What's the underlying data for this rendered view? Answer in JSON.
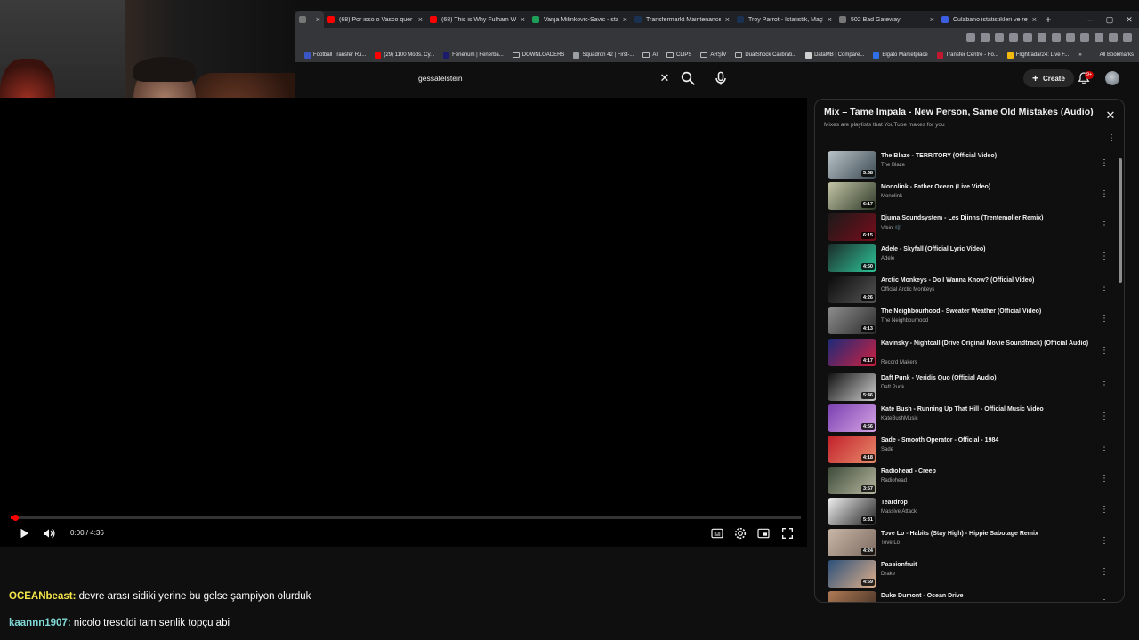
{
  "browser": {
    "tabs": [
      {
        "label": "",
        "color": "#777777",
        "active": true
      },
      {
        "label": "(68) Por isso o Vasco quer CO",
        "color": "#ff0000"
      },
      {
        "label": "(68) This is Why Fulham Wan",
        "color": "#ff0000"
      },
      {
        "label": "Vanja Milinkovic-Savic - statis",
        "color": "#1e9e57"
      },
      {
        "label": "Transfermarkt Maintenance",
        "color": "#1a3151"
      },
      {
        "label": "Troy Parrot - İstatistik, Maçla",
        "color": "#1a3151"
      },
      {
        "label": "502 Bad Gateway",
        "color": "#777777"
      },
      {
        "label": "Culabano istatistikleri ve reyti",
        "color": "#3b5fe0"
      }
    ],
    "new_tab": "+",
    "window_controls": [
      "–",
      "▢",
      "✕"
    ],
    "bookmarks": [
      {
        "label": "Football Transfer Ru...",
        "icon": "tf-icon"
      },
      {
        "label": "(29) 1100 Mods. Cy...",
        "icon": "youtube-icon"
      },
      {
        "label": "Fenerium | Fenerba...",
        "icon": "fenerium-icon"
      },
      {
        "label": "DOWNLOADERS",
        "icon": "folder-icon"
      },
      {
        "label": "Squadron 42 | First-...",
        "icon": "globe-icon"
      },
      {
        "label": "AI",
        "icon": "folder-icon"
      },
      {
        "label": "CLIPS",
        "icon": "folder-icon"
      },
      {
        "label": "ARŞİV",
        "icon": "folder-icon"
      },
      {
        "label": "DualShock Calibrati...",
        "icon": "folder-icon"
      },
      {
        "label": "DataMB | Compare...",
        "icon": "github-icon"
      },
      {
        "label": "Elgato Marketplace",
        "icon": "elgato-icon"
      },
      {
        "label": "Transfer Centre - Fo...",
        "icon": "transfer-icon"
      },
      {
        "label": "Flightradar24: Live F...",
        "icon": "radar-icon"
      }
    ],
    "all_bookmarks": "All Bookmarks"
  },
  "youtube": {
    "search_value": "gessafelstein",
    "create_label": "Create",
    "notification_count": "9+"
  },
  "player": {
    "time": "0:00 / 4:36",
    "progress": 0.004
  },
  "chat": [
    {
      "user": "OCEANbeast:",
      "message": " devre arası sidiki yerine bu gelse şampiyon olurduk"
    },
    {
      "user": "kaannn1907:",
      "message": " nicolo tresoldi tam senlik topçu abi"
    }
  ],
  "playlist": {
    "title": "Mix – Tame Impala - New Person, Same Old Mistakes (Audio)",
    "subtitle": "Mixes are playlists that YouTube makes for you",
    "items": [
      {
        "title": "The Blaze - TERRITORY (Official Video)",
        "channel": "The Blaze",
        "duration": "5:38",
        "c1": "#b9c3c9",
        "c2": "#3d4a52"
      },
      {
        "title": "Monolink - Father Ocean (Live Video)",
        "channel": "Monolink",
        "duration": "6:17",
        "c1": "#c4c6a6",
        "c2": "#2f3a2a"
      },
      {
        "title": "Djuma Soundsystem - Les Djinns (Trentemøller Remix)",
        "channel": "Vibin' 🎼",
        "duration": "6:15",
        "c1": "#1a1a1a",
        "c2": "#7a0d1a"
      },
      {
        "title": "Adele - Skyfall (Official Lyric Video)",
        "channel": "Adele",
        "duration": "4:50",
        "c1": "#1c2b2a",
        "c2": "#2ec79a"
      },
      {
        "title": "Arctic Monkeys - Do I Wanna Know? (Official Video)",
        "channel": "Official Arctic Monkeys",
        "duration": "4:26",
        "c1": "#0a0a0a",
        "c2": "#555555"
      },
      {
        "title": "The Neighbourhood - Sweater Weather (Official Video)",
        "channel": "The Neighbourhood",
        "duration": "4:13",
        "c1": "#8f8f8f",
        "c2": "#2a2a2a"
      },
      {
        "title": "Kavinsky - Nightcall (Drive Original Movie Soundtrack) (Official Audio)",
        "channel": "Record Makers",
        "duration": "4:17",
        "c1": "#1b2a7a",
        "c2": "#d0213f"
      },
      {
        "title": "Daft Punk - Veridis Quo (Official Audio)",
        "channel": "Daft Punk",
        "duration": "5:46",
        "c1": "#111111",
        "c2": "#cfcfcf"
      },
      {
        "title": "Kate Bush - Running Up That Hill - Official Music Video",
        "channel": "KateBushMusic",
        "duration": "4:56",
        "c1": "#7a3fb0",
        "c2": "#d7a6e6"
      },
      {
        "title": "Sade - Smooth Operator - Official - 1984",
        "channel": "Sade",
        "duration": "4:18",
        "c1": "#c21f2a",
        "c2": "#e88c6b"
      },
      {
        "title": "Radiohead - Creep",
        "channel": "Radiohead",
        "duration": "3:57",
        "c1": "#3b4a38",
        "c2": "#b8b8a0"
      },
      {
        "title": "Teardrop",
        "channel": "Massive Attack",
        "duration": "5:31",
        "c1": "#f2f2f2",
        "c2": "#222222"
      },
      {
        "title": "Tove Lo - Habits (Stay High) - Hippie Sabotage Remix",
        "channel": "Tove Lo",
        "duration": "4:24",
        "c1": "#c9b7a8",
        "c2": "#7c6a60"
      },
      {
        "title": "Passionfruit",
        "channel": "Drake",
        "duration": "4:59",
        "c1": "#2a4f7a",
        "c2": "#e0b08a"
      },
      {
        "title": "Duke Dumont - Ocean Drive",
        "channel": "",
        "duration": "",
        "c1": "#b07a55",
        "c2": "#3a2a20"
      }
    ]
  }
}
